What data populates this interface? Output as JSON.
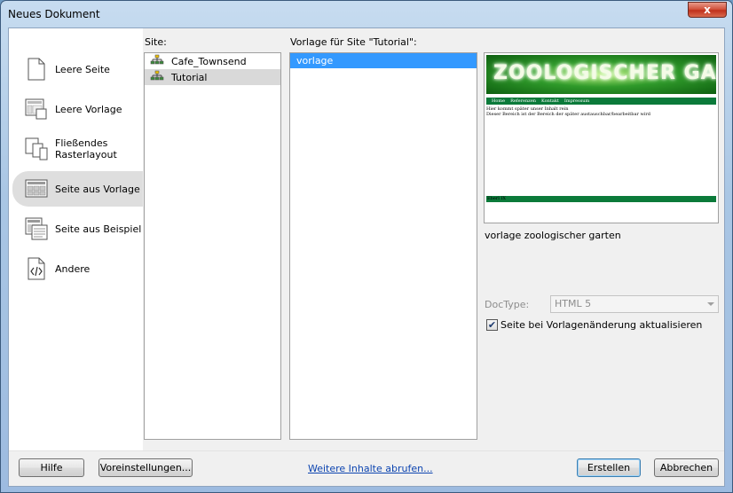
{
  "window": {
    "title": "Neues Dokument",
    "close_glyph": "x"
  },
  "nav": {
    "items": [
      {
        "label": "Leere Seite",
        "icon": "blank-page-icon",
        "selected": false
      },
      {
        "label": "Leere Vorlage",
        "icon": "blank-template-icon",
        "selected": false
      },
      {
        "label": "Fließendes\nRasterlayout",
        "icon": "fluid-grid-icon",
        "selected": false
      },
      {
        "label": "Seite aus Vorlage",
        "icon": "page-from-template-icon",
        "selected": true
      },
      {
        "label": "Seite aus Beispiel",
        "icon": "page-from-sample-icon",
        "selected": false
      },
      {
        "label": "Andere",
        "icon": "code-file-icon",
        "selected": false
      }
    ]
  },
  "site": {
    "label": "Site:",
    "items": [
      {
        "label": "Cafe_Townsend",
        "icon": "site-icon",
        "selected": false
      },
      {
        "label": "Tutorial",
        "icon": "site-icon",
        "selected": true
      }
    ]
  },
  "template": {
    "label": "Vorlage für Site \"Tutorial\":",
    "items": [
      {
        "label": "vorlage",
        "selected": true
      }
    ]
  },
  "preview": {
    "banner": "ZOOLOGISCHER GARTEN",
    "nav_links": [
      "Home",
      "Referenzen",
      "Kontakt",
      "Impressum"
    ],
    "body_lines": [
      "Hier kommt später unser Inhalt rein",
      "Dieser Bereich ist der Bereich der später austauschbar/bearbeitbar wird"
    ],
    "footer": "Eberl IX",
    "caption": "vorlage zoologischer garten"
  },
  "doctype": {
    "label": "DocType:",
    "value": "HTML 5"
  },
  "update_checkbox": {
    "label": "Seite bei Vorlagenänderung aktualisieren",
    "checked": true
  },
  "buttons": {
    "help": "Hilfe",
    "preferences": "Voreinstellungen...",
    "more_content": "Weitere Inhalte abrufen...",
    "create": "Erstellen",
    "cancel": "Abbrechen"
  }
}
